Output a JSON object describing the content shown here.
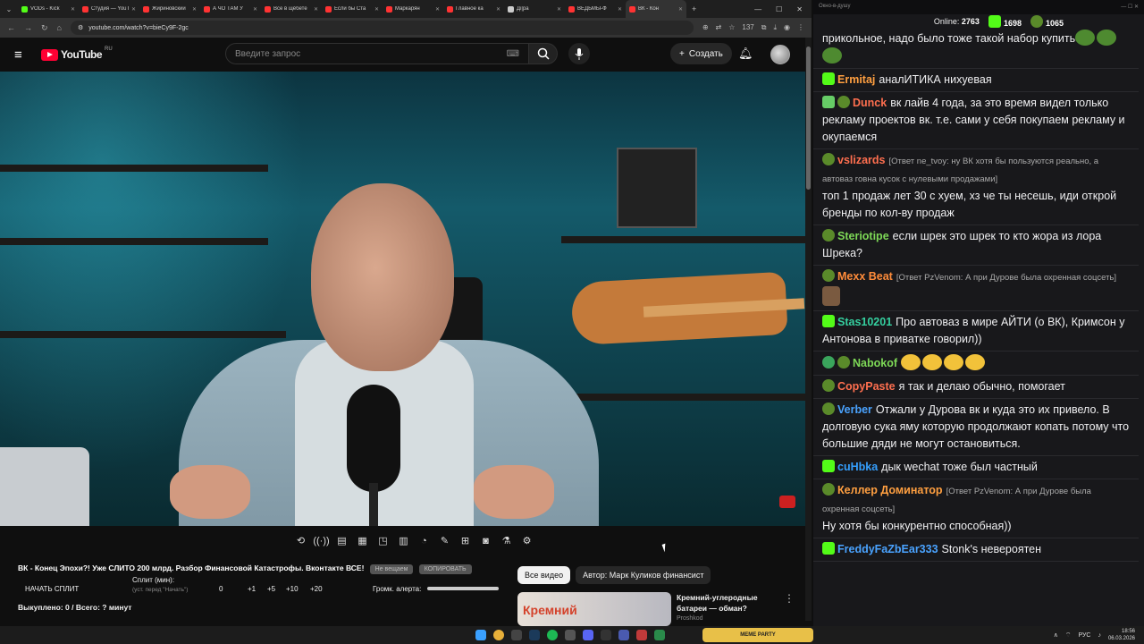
{
  "browser": {
    "tabs": [
      {
        "title": "VODs - Kick",
        "color": "#53fc18"
      },
      {
        "title": "Студия — YouTube",
        "color": "#ff3333"
      },
      {
        "title": "Жириновский",
        "color": "#ff3333"
      },
      {
        "title": "А ЧО ТАМ У",
        "color": "#ff3333"
      },
      {
        "title": "Все в щёбете",
        "color": "#ff3333"
      },
      {
        "title": "Если бы Ста",
        "color": "#ff3333"
      },
      {
        "title": "Маркарян",
        "color": "#ff3333"
      },
      {
        "title": "Главное ка",
        "color": "#ff3333"
      },
      {
        "title": "Дi|ра",
        "color": "#cccccc"
      },
      {
        "title": "ВЕДЬМЫ-Ф",
        "color": "#ff3333"
      },
      {
        "title": "ВК - Кон",
        "color": "#ff3333",
        "active": true
      }
    ],
    "url": "youtube.com/watch?v=bieCy9F-2gc",
    "ext_badge": "137"
  },
  "youtube": {
    "logo": "YouTube",
    "country": "RU",
    "search_placeholder": "Введите запрос",
    "create_label": "Создать"
  },
  "video_panel": {
    "title": "ВК - Конец Эпохи?! Уже СЛИТО 200 млрд. Разбор Финансовой Катастрофы. Вконтакте ВСЕ!",
    "btn_no_stream": "Не вещаем",
    "btn_copy": "КОПИРОВАТЬ",
    "start_split": "НАЧАТЬ СПЛИТ",
    "split_label": "Сплит (мин):",
    "split_hint": "(уст. перед \"Начать\")",
    "split_value": "0",
    "split_steps": [
      "+1",
      "+5",
      "+10",
      "+20"
    ],
    "volume_label": "Громк. алерта:",
    "bought": "Выкуплено: 0 / Всего: ? минут"
  },
  "filters": {
    "all": "Все видео",
    "author": "Автор: Марк Куликов финансист"
  },
  "recommendation": {
    "thumb_text": "Кремний",
    "title": "Кремний-углеродные батареи — обман?",
    "channel": "Proshkod"
  },
  "chat": {
    "header": "Окно-в-душу",
    "online_label": "Online:",
    "online": "2763",
    "kick_count": "1698",
    "other_count": "1065",
    "messages": [
      {
        "nick": "",
        "color": "#ffffff",
        "text": "прикольное, надо было тоже такой набор купить",
        "badges": [],
        "emotes": [
          "pepe",
          "pepe",
          "pepe"
        ]
      },
      {
        "nick": "Ermitaj",
        "color": "#ff9f40",
        "text": "аналИТИКА нихуевая",
        "badges": [
          "kick"
        ]
      },
      {
        "nick": "Dunck",
        "color": "#ff6f4f",
        "text": "вк лайв 4 года, за это время видел только рекламу проектов вк. т.е. сами у себя покупаем рекламу и окупаемся",
        "badges": [
          "edit",
          "pepe"
        ]
      },
      {
        "nick": "vslizards",
        "color": "#ff6f4f",
        "reply": "[Ответ ne_tvoy: ну ВК хотя бы пользуются реально, а автоваз говна кусок с нулевыми продажами]",
        "text": "топ 1 продаж лет 30 с хуем, хз че ты несешь, иди открой бренды по кол-ву продаж",
        "badges": [
          "pepe"
        ]
      },
      {
        "nick": "Steriotipe",
        "color": "#7ed957",
        "text": "если шрек это шрек то кто жора из лора Шрека?",
        "badges": [
          "pepe"
        ]
      },
      {
        "nick": "Mexx Beat",
        "color": "#ff8c3a",
        "reply": "[Ответ PzVenom: А при Дурове была охренная соцсеть]",
        "text": "",
        "badges": [
          "pepe"
        ],
        "emotes": [
          "face"
        ]
      },
      {
        "nick": "Stas10201",
        "color": "#35d0a0",
        "text": "Про автоваз в мире АЙТИ (о ВК), Кримсон у Антонова в приватке говорил))",
        "badges": [
          "kick"
        ]
      },
      {
        "nick": "Nabokof",
        "color": "#7ed957",
        "text": "",
        "badges": [
          "check",
          "pepe"
        ],
        "emotes": [
          "hug",
          "hug",
          "hug",
          "hug"
        ]
      },
      {
        "nick": "CopyPaste",
        "color": "#ff6f4f",
        "text": "я так и делаю обычно, помогает",
        "badges": [
          "pepe"
        ]
      },
      {
        "nick": "Verber",
        "color": "#4aa3ff",
        "text": "Отжали у Дурова вк и куда это их привело. В долговую сука яму которую продолжают копать потому что большие дяди не могут остановиться.",
        "badges": [
          "pepe"
        ]
      },
      {
        "nick": "cuHbka",
        "color": "#35a0ff",
        "text": "дык wechat тоже был частный",
        "badges": [
          "kick"
        ]
      },
      {
        "nick": "Келлер Доминатор",
        "color": "#ff9f40",
        "reply": "[Ответ PzVenom: А при Дурове была охренная соцсеть]",
        "text": "Ну хотя бы конкурентно способная))",
        "badges": [
          "pepe"
        ]
      },
      {
        "nick": "FreddyFaZbEar333",
        "color": "#4aa3ff",
        "text": "Stonk's невероятен",
        "badges": [
          "kick"
        ]
      }
    ]
  },
  "taskbar": {
    "game_label": "MEME PARTY",
    "lang": "РУС",
    "time": "18:56",
    "date": "06.03.2026"
  },
  "colors": {
    "yt_red": "#ff0033",
    "kick_green": "#53fc18",
    "chat_bg": "#18181b"
  }
}
